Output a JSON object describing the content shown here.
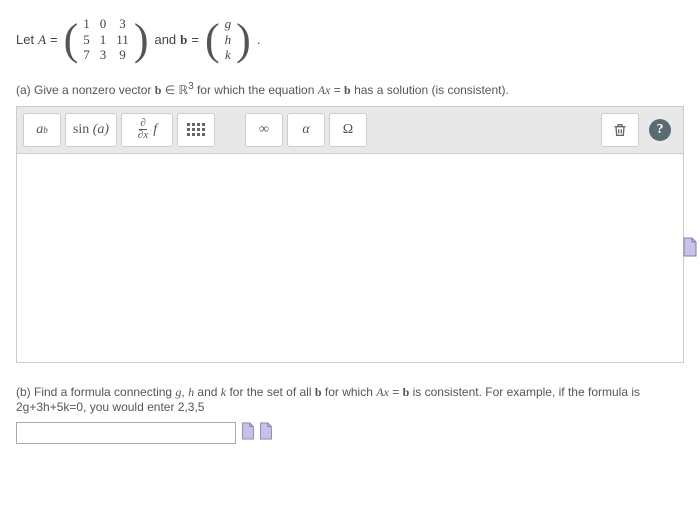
{
  "statement": {
    "let_text": "Let ",
    "A_sym": "A",
    "eq": " = ",
    "matrixA": [
      [
        "1",
        "0",
        "3"
      ],
      [
        "5",
        "1",
        "11"
      ],
      [
        "7",
        "3",
        "9"
      ]
    ],
    "and_text": " and ",
    "b_sym": "b",
    "matrixB": [
      [
        "g"
      ],
      [
        "h"
      ],
      [
        "k"
      ]
    ],
    "period": " ."
  },
  "partA": {
    "prefix": "(a) Give a nonzero vector ",
    "b": "b",
    "in": " ∈ ",
    "R": "ℝ",
    "exp": "3",
    "mid": " for which the equation ",
    "Ax": "Ax",
    "eq": " = ",
    "b2": "b",
    "suffix": " has a solution (is consistent)."
  },
  "toolbar": {
    "ab_base": "a",
    "ab_exp": "b",
    "sin": "sin",
    "sin_arg": "(a)",
    "partial_num": "∂",
    "partial_den": "∂x",
    "f": "f",
    "infty": "∞",
    "alpha": "α",
    "omega": "Ω"
  },
  "partB": {
    "prefix": "(b) Find a formula connecting ",
    "g": "g",
    "c1": ", ",
    "h": "h",
    "and": " and ",
    "k": "k",
    "mid": " for the set of all ",
    "b": "b",
    "mid2": " for which ",
    "Ax": "Ax",
    "eq": " = ",
    "b2": "b",
    "mid3": " is consistent. For example, if the formula is ",
    "line2": "2g+3h+5k=0, you would enter 2,3,5"
  },
  "input": {
    "value": ""
  },
  "chart_data": {
    "type": "table",
    "title": "Matrices from problem",
    "series": [
      {
        "name": "A",
        "values": [
          [
            1,
            0,
            3
          ],
          [
            5,
            1,
            11
          ],
          [
            7,
            3,
            9
          ]
        ]
      },
      {
        "name": "b",
        "values": [
          "g",
          "h",
          "k"
        ]
      }
    ]
  }
}
